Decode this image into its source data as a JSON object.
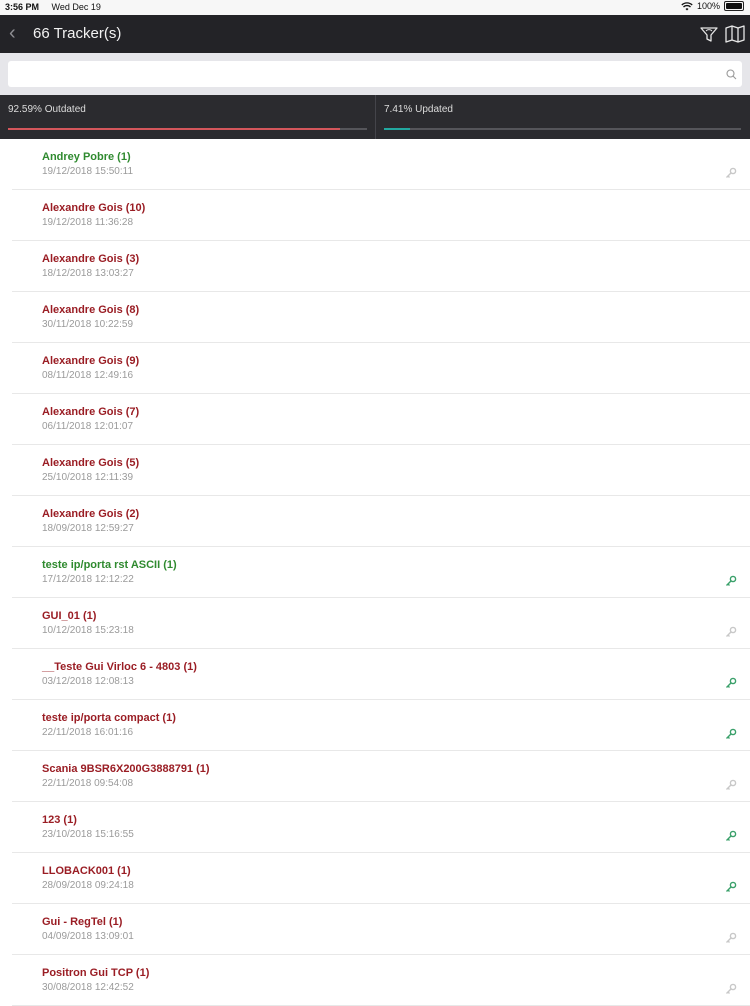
{
  "status": {
    "time": "3:56 PM",
    "date": "Wed Dec 19",
    "battery": "100%"
  },
  "nav": {
    "title": "66 Tracker(s)"
  },
  "search": {
    "value": "",
    "placeholder": ""
  },
  "stats": {
    "outdated_label": "92.59% Outdated",
    "outdated_percent": 92.59,
    "updated_label": "7.41% Updated",
    "updated_percent": 7.41
  },
  "colors": {
    "online": "#2f8a2f",
    "offline": "#9a1d24",
    "key_active": "#3aa06a",
    "key_inactive": "#c8c8c8"
  },
  "trackers": [
    {
      "name": "Andrey Pobre (1)",
      "time": "19/12/2018 15:50:11",
      "status": "green",
      "key": "inactive"
    },
    {
      "name": "Alexandre Gois (10)",
      "time": "19/12/2018 11:36:28",
      "status": "red",
      "key": "none"
    },
    {
      "name": "Alexandre Gois (3)",
      "time": "18/12/2018 13:03:27",
      "status": "red",
      "key": "none"
    },
    {
      "name": "Alexandre Gois (8)",
      "time": "30/11/2018 10:22:59",
      "status": "red",
      "key": "none"
    },
    {
      "name": "Alexandre Gois (9)",
      "time": "08/11/2018 12:49:16",
      "status": "red",
      "key": "none"
    },
    {
      "name": "Alexandre Gois (7)",
      "time": "06/11/2018 12:01:07",
      "status": "red",
      "key": "none"
    },
    {
      "name": "Alexandre Gois (5)",
      "time": "25/10/2018 12:11:39",
      "status": "red",
      "key": "none"
    },
    {
      "name": "Alexandre Gois (2)",
      "time": "18/09/2018 12:59:27",
      "status": "red",
      "key": "none"
    },
    {
      "name": "teste ip/porta rst ASCII (1)",
      "time": "17/12/2018 12:12:22",
      "status": "green",
      "key": "active"
    },
    {
      "name": "GUI_01 (1)",
      "time": "10/12/2018 15:23:18",
      "status": "red",
      "key": "inactive"
    },
    {
      "name": "__Teste Gui Virloc 6 - 4803 (1)",
      "time": "03/12/2018 12:08:13",
      "status": "red",
      "key": "active"
    },
    {
      "name": "teste ip/porta compact (1)",
      "time": "22/11/2018 16:01:16",
      "status": "red",
      "key": "active"
    },
    {
      "name": "Scania 9BSR6X200G3888791 (1)",
      "time": "22/11/2018 09:54:08",
      "status": "red",
      "key": "inactive"
    },
    {
      "name": "123 (1)",
      "time": "23/10/2018 15:16:55",
      "status": "red",
      "key": "active"
    },
    {
      "name": "LLOBACK001 (1)",
      "time": "28/09/2018 09:24:18",
      "status": "red",
      "key": "active"
    },
    {
      "name": "Gui - RegTel (1)",
      "time": "04/09/2018 13:09:01",
      "status": "red",
      "key": "inactive"
    },
    {
      "name": "Positron Gui TCP (1)",
      "time": "30/08/2018 12:42:52",
      "status": "red",
      "key": "inactive"
    }
  ]
}
